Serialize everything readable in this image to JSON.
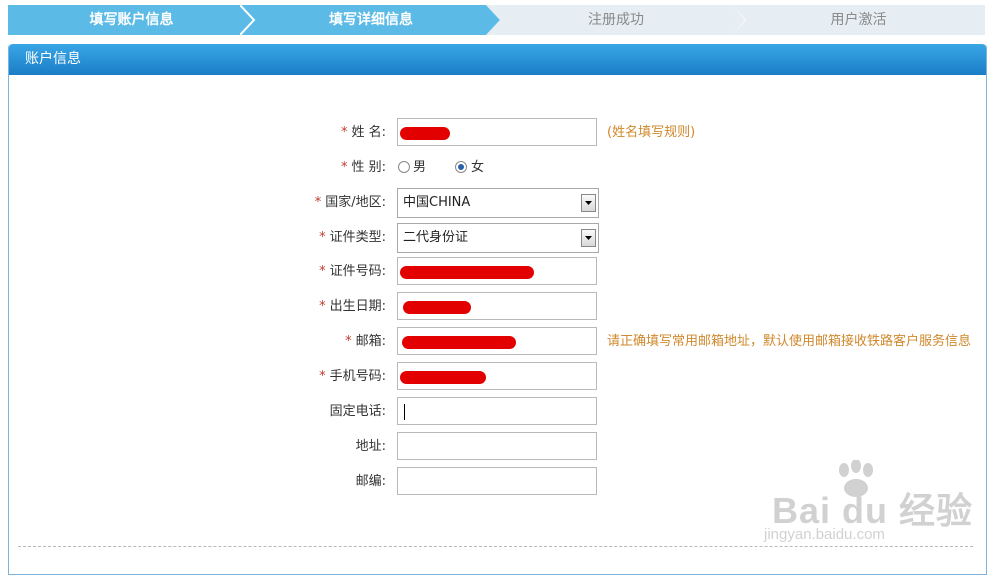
{
  "steps": [
    {
      "label": "填写账户信息",
      "state": "done"
    },
    {
      "label": "填写详细信息",
      "state": "current"
    },
    {
      "label": "注册成功",
      "state": "pending"
    },
    {
      "label": "用户激活",
      "state": "pending"
    }
  ],
  "colors": {
    "active_step": "#5bbbe6",
    "inactive_step": "#e6eef3",
    "header": "#2790d6",
    "required": "#c0392b",
    "hint": "#d0882b"
  },
  "panel": {
    "title": "账户信息"
  },
  "form": {
    "required_mark": "*",
    "name": {
      "label": "姓 名:",
      "hint": "(姓名填写规则)"
    },
    "gender": {
      "label": "性 别:",
      "options": [
        "男",
        "女"
      ],
      "selected": "女"
    },
    "country": {
      "label": "国家/地区:",
      "value": "中国CHINA"
    },
    "id_type": {
      "label": "证件类型:",
      "value": "二代身份证"
    },
    "id_number": {
      "label": "证件号码:"
    },
    "birth_date": {
      "label": "出生日期:"
    },
    "email": {
      "label": "邮箱:",
      "hint": "请正确填写常用邮箱地址，默认使用邮箱接收铁路客户服务信息"
    },
    "mobile": {
      "label": "手机号码:"
    },
    "phone": {
      "label": "固定电话:"
    },
    "address": {
      "label": "地址:"
    },
    "postcode": {
      "label": "邮编:"
    }
  },
  "watermark": {
    "logo": "Bai du 经验",
    "sub": "jingyan.baidu.com"
  }
}
